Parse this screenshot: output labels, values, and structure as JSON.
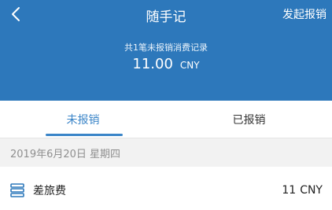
{
  "header": {
    "title": "随手记",
    "action_label": "发起报销",
    "summary_label": "共1笔未报销消费记录",
    "amount": "11.00",
    "currency": "CNY",
    "background_color": "#2d78bb"
  },
  "tabs": [
    {
      "label": "未报销",
      "active": true
    },
    {
      "label": "已报销",
      "active": false
    }
  ],
  "date_group": {
    "label": "2019年6月20日 星期四"
  },
  "records": [
    {
      "icon": "list-icon",
      "category": "差旅费",
      "amount": "11",
      "currency": "CNY"
    }
  ],
  "colors": {
    "accent": "#3b85c8",
    "header": "#2d78bb"
  }
}
